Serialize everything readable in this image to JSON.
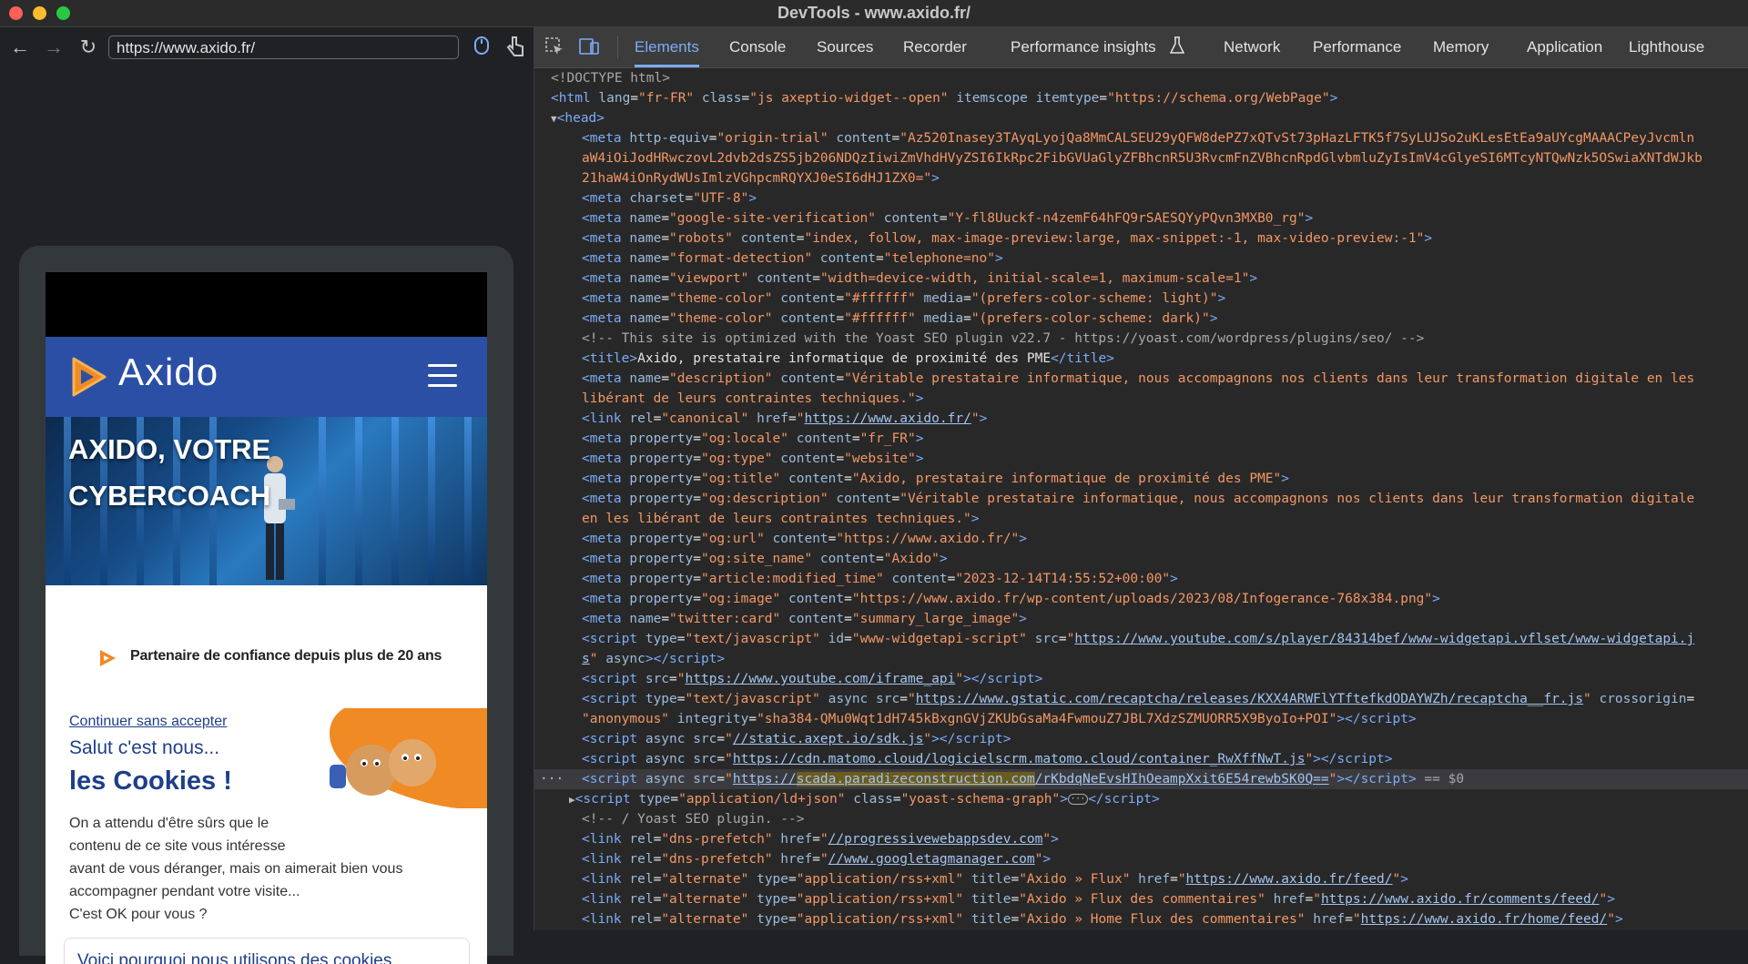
{
  "window": {
    "title": "DevTools - www.axido.fr/"
  },
  "browser": {
    "url": "https://www.axido.fr/"
  },
  "site": {
    "logo_text": "Axido",
    "hero_title_line1": "AXIDO, VOTRE",
    "hero_title_line2": "CYBERCOACH",
    "partner_text": "Partenaire de confiance depuis plus de 20 ans",
    "cookie": {
      "continue_link": "Continuer sans accepter",
      "hello": "Salut c'est nous...",
      "title": "les Cookies !",
      "body_lines": [
        "On a attendu d'être sûrs que le",
        "contenu de ce site vous intéresse",
        "avant de vous déranger, mais on aimerait bien vous",
        "accompagner pendant votre visite...",
        "C'est OK pour vous ?"
      ],
      "why_label": "Voici pourquoi nous utilisons des cookies"
    }
  },
  "devtools": {
    "tabs": [
      "Elements",
      "Console",
      "Sources",
      "Recorder",
      "Performance insights",
      "Network",
      "Performance",
      "Memory",
      "Application",
      "Lighthouse"
    ],
    "active_tab": "Elements",
    "selected_suffix": " == $0"
  },
  "icons": {
    "back": "arrow-left-icon",
    "forward": "arrow-right-icon",
    "reload": "reload-icon",
    "inspect": "inspect-element-icon",
    "device": "device-toolbar-icon",
    "flask": "flask-icon",
    "ellipsis": "ellipsis-icon"
  },
  "colors": {
    "active_tab": "#7cacf8",
    "site_header": "#2b4fa5",
    "cookie_accent": "#1f3e8a",
    "brand_orange": "#f08a24"
  }
}
